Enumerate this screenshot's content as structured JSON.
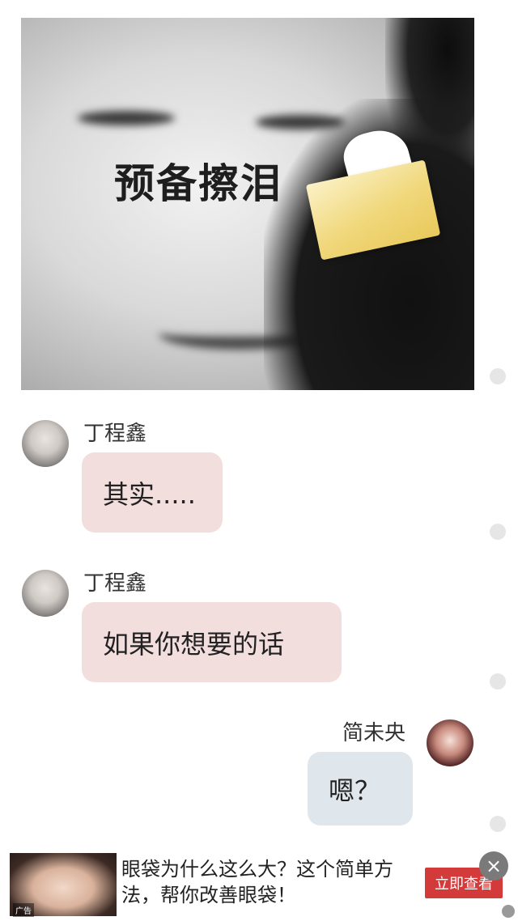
{
  "meme": {
    "caption": "预备擦泪"
  },
  "messages": [
    {
      "side": "left",
      "sender": "丁程鑫",
      "text": "其实....."
    },
    {
      "side": "left",
      "sender": "丁程鑫",
      "text": "如果你想要的话"
    },
    {
      "side": "right",
      "sender": "简未央",
      "text": "嗯？"
    }
  ],
  "ad": {
    "text": "眼袋为什么这么大？这个简单方法，帮你改善眼袋！",
    "button_label": "立即查看",
    "tag": "广告",
    "close_icon": "×"
  }
}
